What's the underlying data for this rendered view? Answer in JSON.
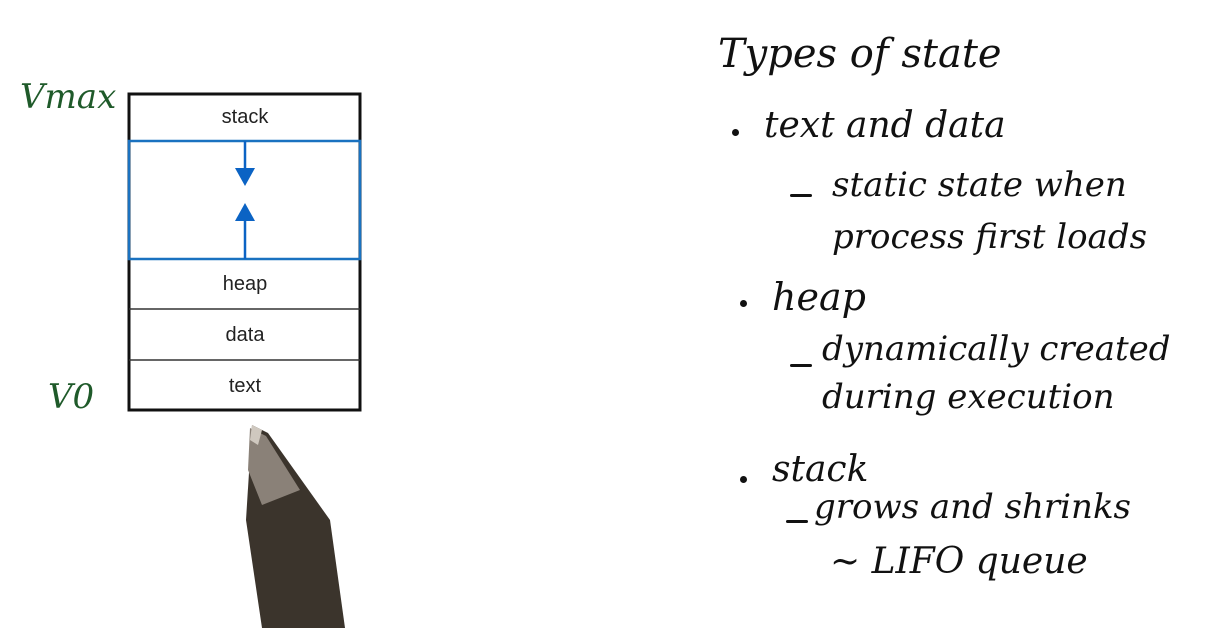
{
  "diagram": {
    "address_labels": {
      "top": "Vmax",
      "bottom": "V0"
    },
    "segments": [
      "stack",
      "heap",
      "data",
      "text"
    ],
    "colors": {
      "box_border": "#111111",
      "gap_border": "#1a72c0",
      "arrow": "#0b63c4",
      "address_ink": "#1f5a2a",
      "notes_ink": "#111111"
    }
  },
  "notes": {
    "title": "Types of state",
    "items": [
      {
        "heading": "text and data",
        "detail_lines": [
          "static state when",
          "process first loads"
        ]
      },
      {
        "heading": "heap",
        "detail_lines": [
          "dynamically created",
          "during execution"
        ]
      },
      {
        "heading": "stack",
        "detail_lines": [
          "grows and shrinks",
          "~ LIFO queue"
        ]
      }
    ]
  }
}
